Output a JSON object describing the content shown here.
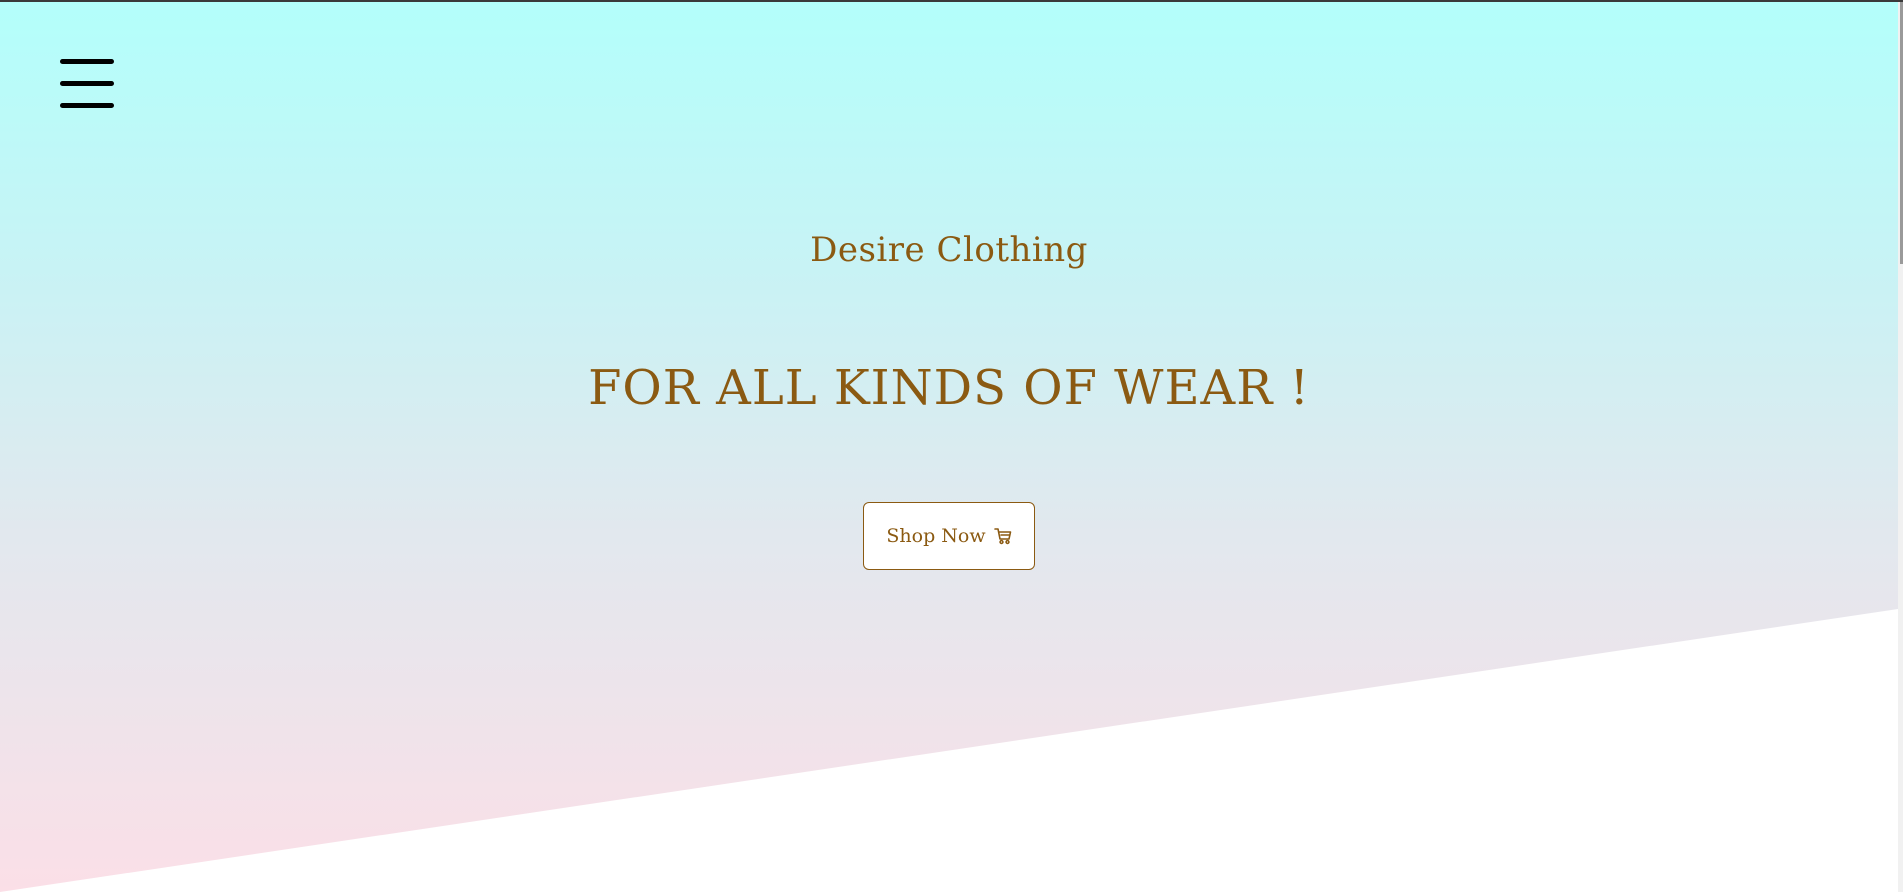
{
  "hero": {
    "brand": "Desire Clothing",
    "tagline": "FOR ALL KINDS OF WEAR !",
    "cta_label": "Shop Now",
    "cta_icon": "cart-icon"
  },
  "nav": {
    "menu_icon": "hamburger-menu-icon"
  },
  "colors": {
    "accent": "#8b5a12",
    "gradient_top": "#b3fffb",
    "gradient_bottom": "#fbdfe7"
  }
}
